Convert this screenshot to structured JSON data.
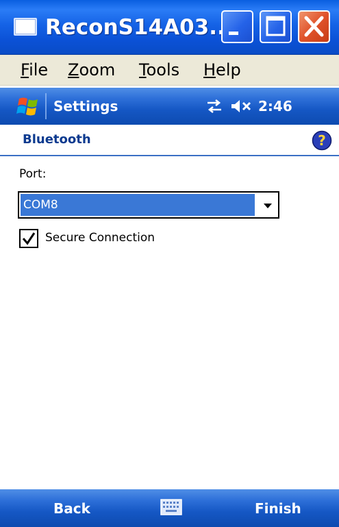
{
  "window": {
    "title": "ReconS14A03...",
    "app_icon": "window-app-icon",
    "controls": [
      "minimize-icon",
      "maximize-icon",
      "close-icon"
    ]
  },
  "menubar": {
    "items": [
      {
        "mnemonic": "F",
        "rest": "ile"
      },
      {
        "mnemonic": "Z",
        "rest": "oom"
      },
      {
        "mnemonic": "T",
        "rest": "ools"
      },
      {
        "mnemonic": "H",
        "rest": "elp"
      }
    ]
  },
  "navbar": {
    "start_icon": "windows-start-icon",
    "title": "Settings",
    "status_icons": [
      "connectivity-icon",
      "volume-muted-icon"
    ],
    "time": "2:46"
  },
  "page": {
    "title": "Bluetooth",
    "help_icon": "help-icon",
    "port_label": "Port:",
    "port_value": "COM8",
    "secure_label": "Secure Connection",
    "secure_checked": true
  },
  "softkeys": {
    "left": "Back",
    "center_icon": "keyboard-icon",
    "right": "Finish"
  },
  "colors": {
    "title_bar": "#1563e6",
    "nav_bar": "#2d6fd8",
    "selection": "#3a78d6",
    "header_text": "#0c3a8f",
    "close_button": "#e0532a"
  }
}
